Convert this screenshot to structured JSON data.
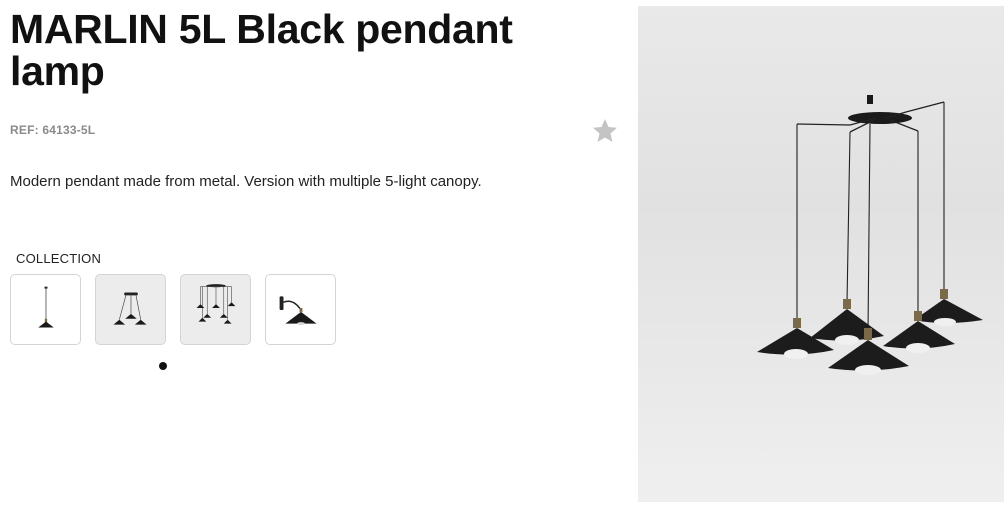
{
  "product": {
    "title": "MARLIN 5L Black pendant lamp",
    "ref": "REF: 64133-5L",
    "description": "Modern pendant made from metal. Version with multiple 5-light canopy."
  },
  "favorite": {
    "icon": "star-icon",
    "color": "#c4c4c4"
  },
  "collection": {
    "label": "COLLECTION",
    "thumbnails": [
      {
        "name": "marlin-1l-pendant",
        "icon": "single-pendant-lamp-icon",
        "selected": false
      },
      {
        "name": "marlin-3l-pendant",
        "icon": "three-pendant-lamp-icon",
        "selected": true
      },
      {
        "name": "marlin-7l-pendant",
        "icon": "multi-pendant-lamp-icon",
        "selected": false
      },
      {
        "name": "marlin-wall-lamp",
        "icon": "wall-lamp-icon",
        "selected": false
      }
    ],
    "active_index": 1
  },
  "main_image": {
    "alt": "MARLIN 5L Black pendant lamp",
    "background": "#e6e6e6"
  },
  "colors": {
    "text": "#111111",
    "muted": "#8a8a8a",
    "lamp": "#1a1a1a",
    "brass": "#7a6a4a"
  }
}
